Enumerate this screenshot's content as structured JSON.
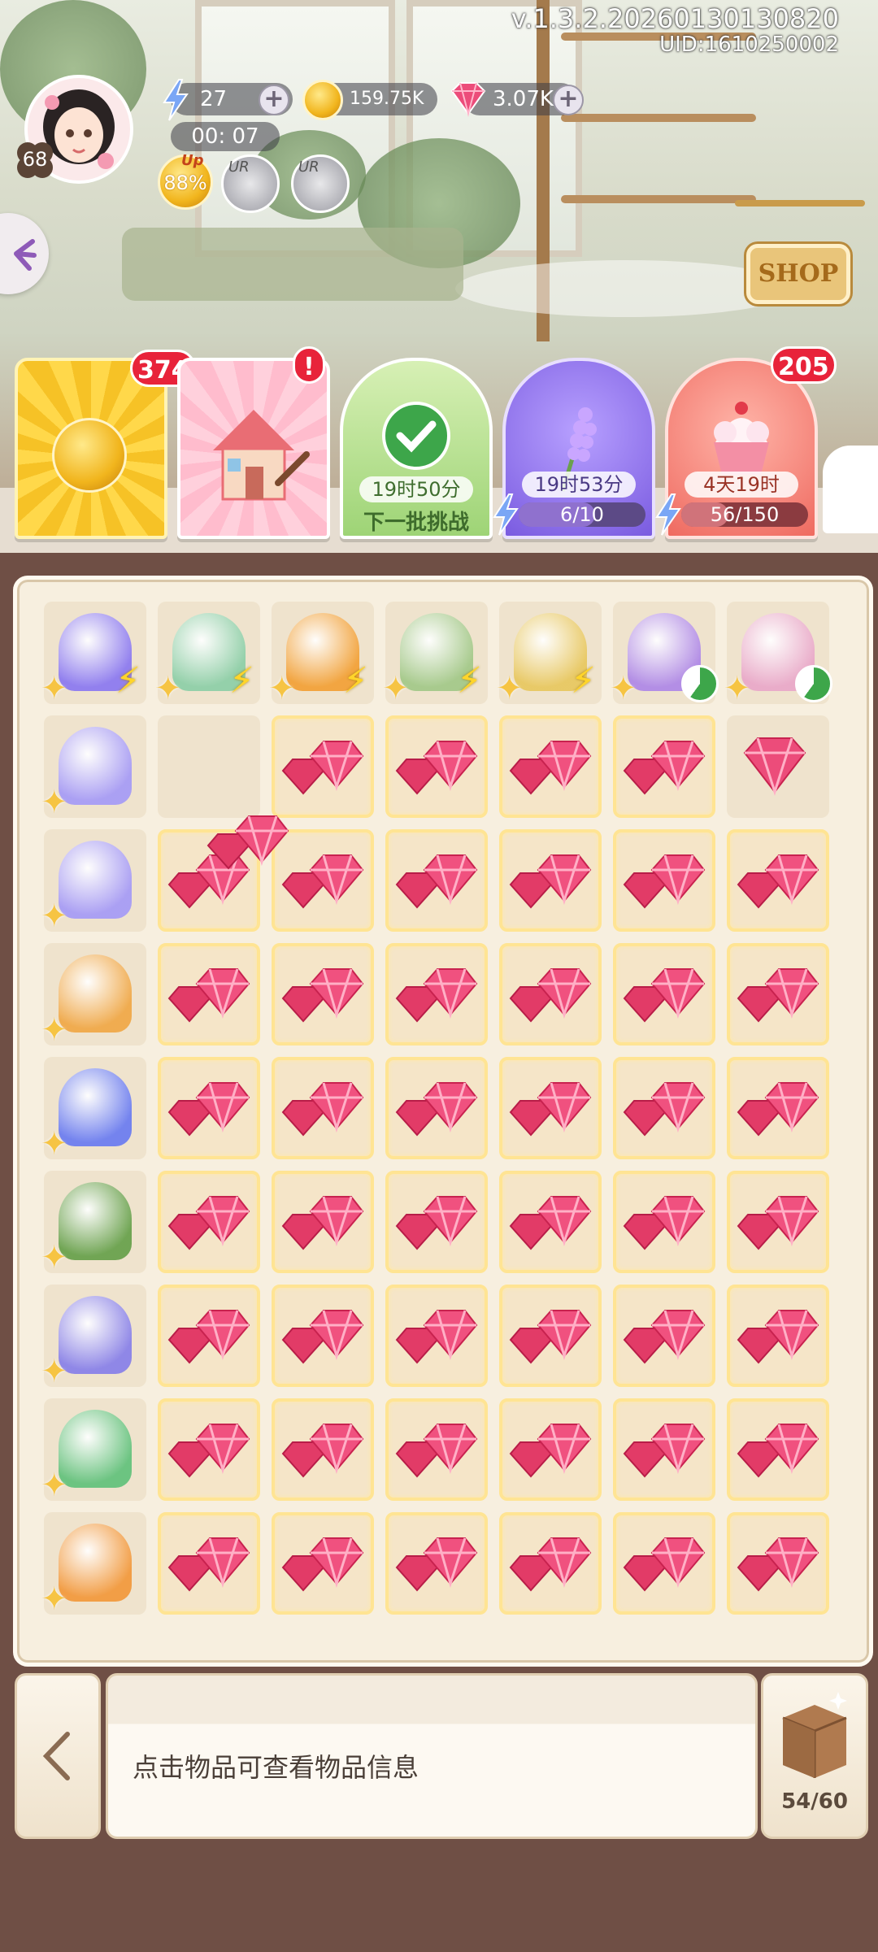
{
  "header": {
    "version": "v.1.3.2.20260130130820",
    "uid": "UID:1610250002",
    "level": "68",
    "energy": "27",
    "timer": "00: 07",
    "coins": "159.75K",
    "gems": "3.07K",
    "up_percent": "88%",
    "up_label": "Up",
    "ur_label": "UR",
    "shop_label": "SHOP"
  },
  "cards": [
    {
      "name": "clover-coin",
      "badge": "374"
    },
    {
      "name": "house-decor",
      "badge": "!"
    },
    {
      "name": "daily-challenge",
      "time": "19时50分",
      "sub": "下一批挑战"
    },
    {
      "name": "lavender",
      "time": "19时53分",
      "progress": "6/10",
      "fill": 0.6
    },
    {
      "name": "cupcake",
      "badge": "205",
      "time": "4天19时",
      "progress": "56/150",
      "fill": 0.37
    }
  ],
  "board": {
    "generators": [
      "galaxy-orb",
      "crystal-house",
      "teapot",
      "flower-cart",
      "cabinet",
      "potion-bottle",
      "ribbon-potion"
    ],
    "rows": [
      {
        "generator": "bubble-orb",
        "cells": [
          "empty",
          "gem",
          "gem",
          "gem",
          "gem",
          "gem-single"
        ]
      },
      {
        "generator": "bubble-orb",
        "cells": [
          "gem",
          "gem",
          "gem",
          "gem",
          "gem",
          "gem"
        ]
      },
      {
        "generator": "golden-tree-dome",
        "cells": [
          "gem",
          "gem",
          "gem",
          "gem",
          "gem",
          "gem"
        ]
      },
      {
        "generator": "blue-tree-dome",
        "cells": [
          "gem",
          "gem",
          "gem",
          "gem",
          "gem",
          "gem"
        ]
      },
      {
        "generator": "apple-tree-dome",
        "cells": [
          "gem",
          "gem",
          "gem",
          "gem",
          "gem",
          "gem"
        ]
      },
      {
        "generator": "lavender-dome",
        "cells": [
          "gem",
          "gem",
          "gem",
          "gem",
          "gem",
          "gem"
        ]
      },
      {
        "generator": "leaf-dome",
        "cells": [
          "gem",
          "gem",
          "gem",
          "gem",
          "gem",
          "gem"
        ]
      },
      {
        "generator": "clownfish",
        "cells": [
          "gem",
          "gem",
          "gem",
          "gem",
          "gem",
          "gem"
        ]
      }
    ]
  },
  "footer": {
    "info_text": "点击物品可查看物品信息",
    "inventory": "54/60",
    "back_icon": "chevron-left-icon",
    "box_icon": "box-icon"
  },
  "colors": {
    "gem": "#e8476f",
    "cell_border": "#ffe493",
    "badge": "#e8233a"
  }
}
